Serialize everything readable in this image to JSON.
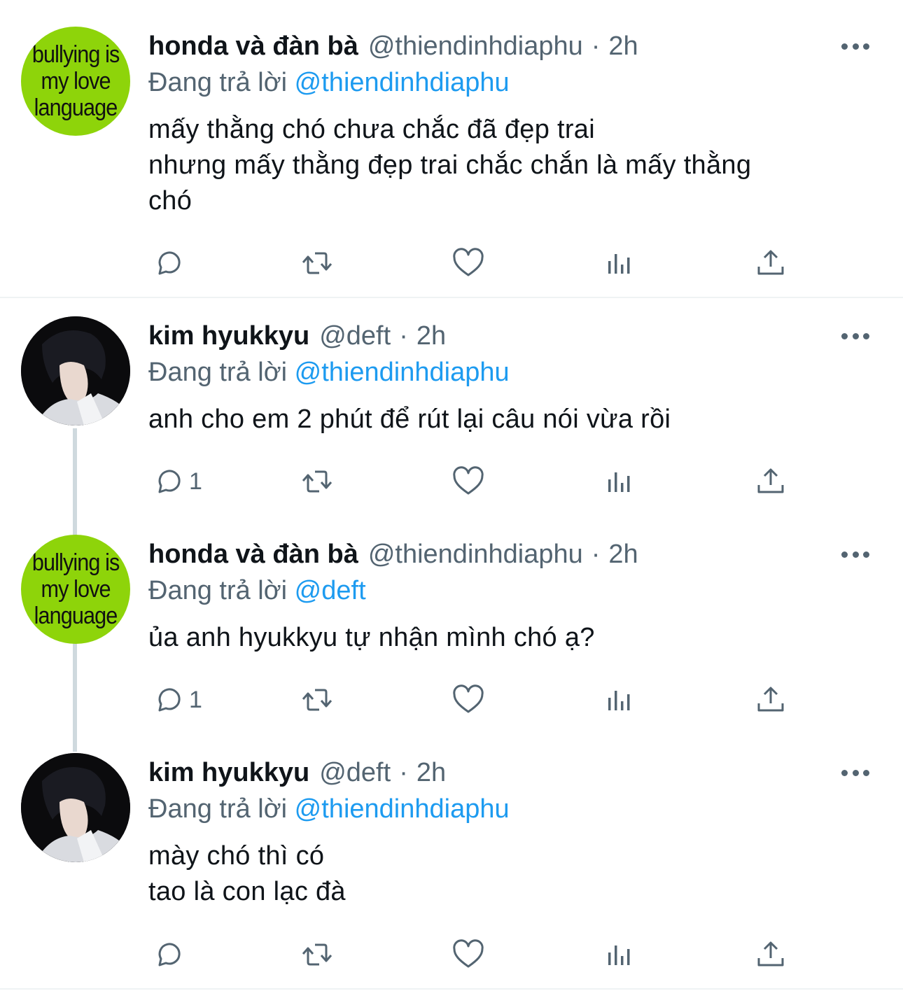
{
  "tweets": [
    {
      "name": "honda và đàn bà",
      "handle": "@thiendinhdiaphu",
      "dot": "·",
      "time": "2h",
      "reply_prefix": "Đang trả lời",
      "reply_to": "@thiendinhdiaphu",
      "text": "mấy thằng chó chưa chắc đã đẹp trai\nnhưng mấy thằng đẹp trai chắc chắn là mấy thằng\nchó",
      "avatar_lines": [
        "bullying is",
        "my love",
        "language"
      ],
      "reply_count": ""
    },
    {
      "name": "kim hyukkyu",
      "handle": "@deft",
      "dot": "·",
      "time": "2h",
      "reply_prefix": "Đang trả lời",
      "reply_to": "@thiendinhdiaphu",
      "text": "anh cho em 2 phút để rút lại câu nói vừa rồi",
      "reply_count": "1"
    },
    {
      "name": "honda và đàn bà",
      "handle": "@thiendinhdiaphu",
      "dot": "·",
      "time": "2h",
      "reply_prefix": "Đang trả lời",
      "reply_to": "@deft",
      "text": "ủa anh hyukkyu tự nhận mình chó ạ?",
      "avatar_lines": [
        "bullying is",
        "my love",
        "language"
      ],
      "reply_count": "1"
    },
    {
      "name": "kim hyukkyu",
      "handle": "@deft",
      "dot": "·",
      "time": "2h",
      "reply_prefix": "Đang trả lời",
      "reply_to": "@thiendinhdiaphu",
      "text": "mày chó thì có\ntao là con lạc đà",
      "reply_count": ""
    }
  ],
  "action_icons": [
    "reply-icon",
    "retweet-icon",
    "like-icon",
    "analytics-icon",
    "share-icon"
  ],
  "colors": {
    "accent": "#1d9bf0",
    "muted": "#536471",
    "avatar_green": "#8ed40a"
  }
}
